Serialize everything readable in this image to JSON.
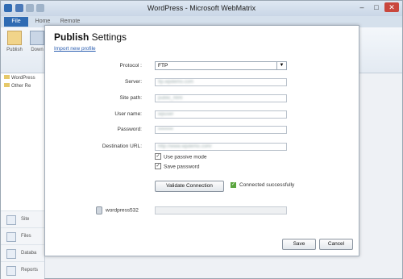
{
  "window": {
    "title": "WordPress - Microsoft WebMatrix",
    "controls": {
      "minimize": "–",
      "maximize": "□",
      "close": "✕"
    }
  },
  "ribbon_tabs": [
    "File",
    "Home",
    "Remote"
  ],
  "ribbon_buttons": [
    "Publish",
    "Down"
  ],
  "left_pane": {
    "tree": [
      "WordPress",
      "Other Re"
    ],
    "workspaces": [
      "Site",
      "Files",
      "Databa",
      "Reports"
    ]
  },
  "dialog": {
    "title_bold": "Publish",
    "title_rest": " Settings",
    "import_link": "Import new profile",
    "protocol": {
      "label": "Protocol :",
      "value": "FTP"
    },
    "server": {
      "label": "Server:",
      "value": "ftp.wpdemo.com"
    },
    "site_path": {
      "label": "Site path:",
      "value": "public_html"
    },
    "user_name": {
      "label": "User name:",
      "value": "wpuser"
    },
    "password": {
      "label": "Password:",
      "value": "•••••••••"
    },
    "destination_url": {
      "label": "Destination URL:",
      "value": "http://www.wpdemo.com/"
    },
    "use_passive": {
      "label": "Use passive mode",
      "checked": true
    },
    "save_password": {
      "label": "Save password",
      "checked": true
    },
    "validate_button": "Validate Connection",
    "status_text": "Connected successfully",
    "database_name": "wordpress532",
    "save_button": "Save",
    "cancel_button": "Cancel"
  },
  "colors": {
    "accent": "#2f6bb3",
    "success": "#5aa53e",
    "link": "#2a5db0"
  }
}
